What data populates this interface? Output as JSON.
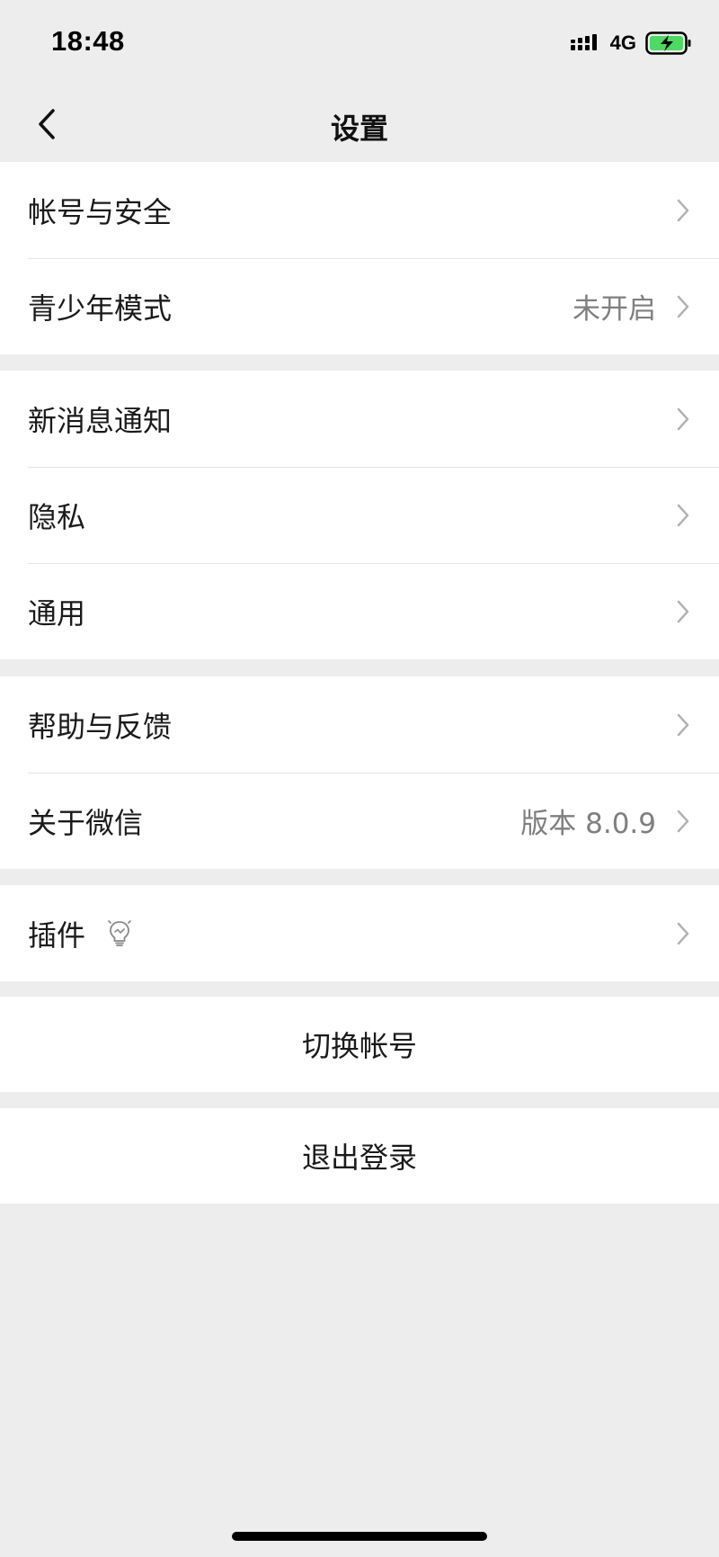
{
  "status_bar": {
    "time": "18:48",
    "network": "4G"
  },
  "nav": {
    "title": "设置"
  },
  "groups": [
    {
      "items": [
        {
          "label": "帐号与安全",
          "value": ""
        },
        {
          "label": "青少年模式",
          "value": "未开启"
        }
      ]
    },
    {
      "items": [
        {
          "label": "新消息通知",
          "value": ""
        },
        {
          "label": "隐私",
          "value": ""
        },
        {
          "label": "通用",
          "value": ""
        }
      ]
    },
    {
      "items": [
        {
          "label": "帮助与反馈",
          "value": ""
        },
        {
          "label": "关于微信",
          "value": "版本 8.0.9"
        }
      ]
    },
    {
      "items": [
        {
          "label": "插件",
          "value": "",
          "icon": "lightbulb-icon"
        }
      ]
    }
  ],
  "actions": {
    "switch_account": "切换帐号",
    "logout": "退出登录"
  },
  "colors": {
    "background": "#ededed",
    "card": "#ffffff",
    "secondary_text": "#7f7f7f",
    "battery_green": "#4cd964"
  }
}
